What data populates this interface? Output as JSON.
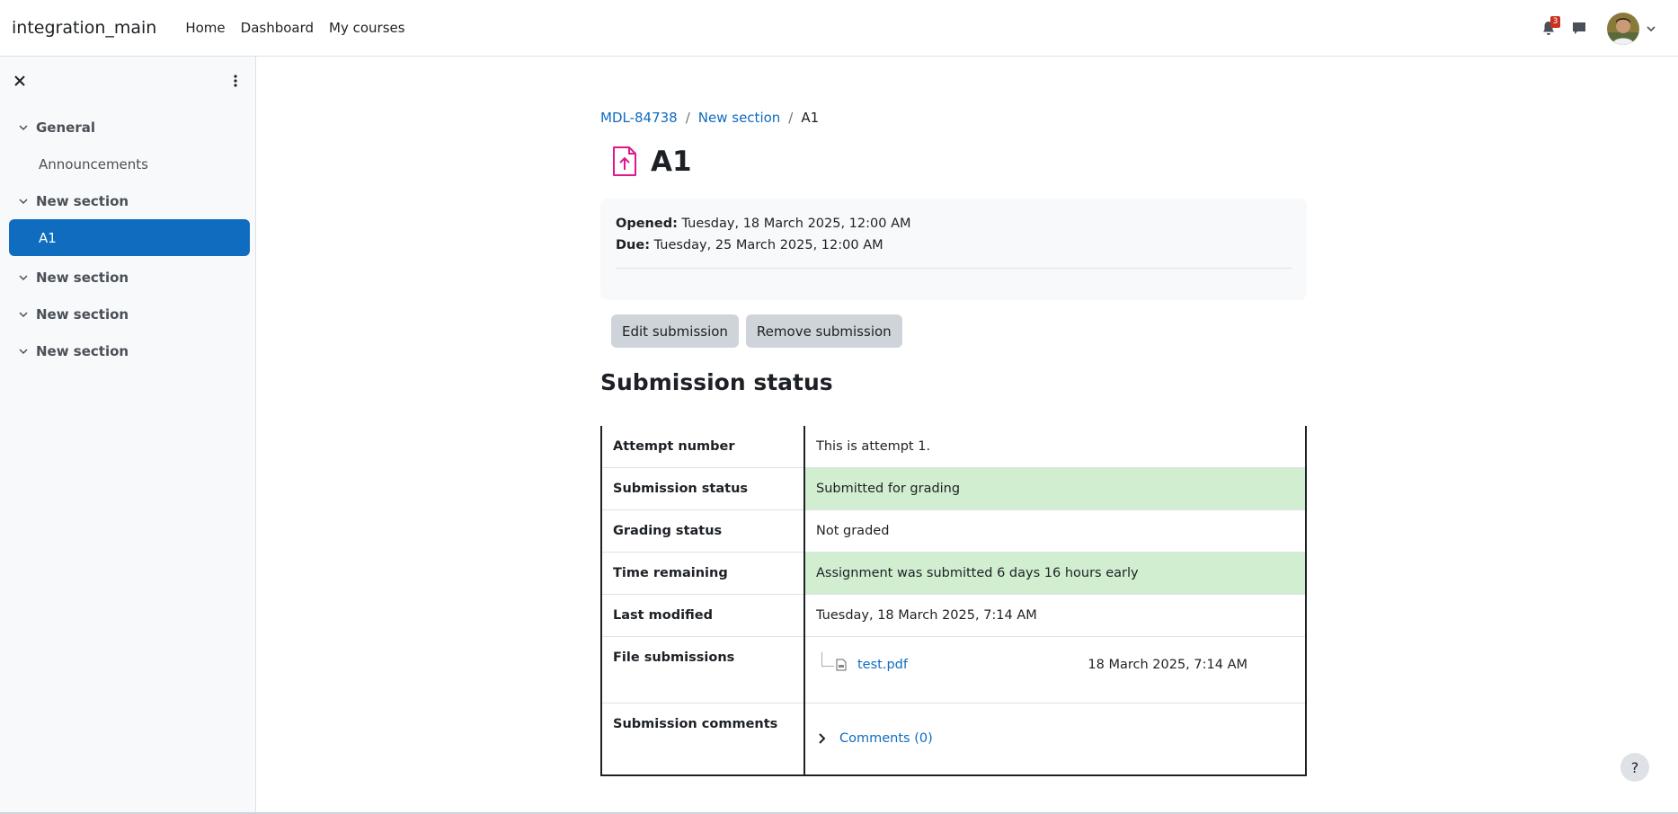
{
  "navbar": {
    "brand": "integration_main",
    "links": [
      "Home",
      "Dashboard",
      "My courses"
    ],
    "notification_count": "3"
  },
  "drawer": {
    "sections": [
      {
        "title": "General",
        "items": [
          "Announcements"
        ]
      },
      {
        "title": "New section",
        "items": [
          "A1"
        ]
      },
      {
        "title": "New section",
        "items": []
      },
      {
        "title": "New section",
        "items": []
      },
      {
        "title": "New section",
        "items": []
      }
    ],
    "active_item": "A1"
  },
  "breadcrumb": [
    "MDL-84738",
    "New section",
    "A1"
  ],
  "page_title": "A1",
  "dates": {
    "opened_label": "Opened:",
    "opened_value": "Tuesday, 18 March 2025, 12:00 AM",
    "due_label": "Due:",
    "due_value": "Tuesday, 25 March 2025, 12:00 AM"
  },
  "buttons": {
    "edit": "Edit submission",
    "remove": "Remove submission"
  },
  "status_heading": "Submission status",
  "status_table": [
    {
      "label": "Attempt number",
      "value": "This is attempt 1.",
      "highlight": false
    },
    {
      "label": "Submission status",
      "value": "Submitted for grading",
      "highlight": true
    },
    {
      "label": "Grading status",
      "value": "Not graded",
      "highlight": false
    },
    {
      "label": "Time remaining",
      "value": "Assignment was submitted 6 days 16 hours early",
      "highlight": true
    },
    {
      "label": "Last modified",
      "value": "Tuesday, 18 March 2025, 7:14 AM",
      "highlight": false
    }
  ],
  "file_submissions": {
    "label": "File submissions",
    "file_name": "test.pdf",
    "file_date": "18 March 2025, 7:14 AM"
  },
  "submission_comments": {
    "label": "Submission comments",
    "link": "Comments (0)"
  },
  "help_label": "?",
  "colors": {
    "primary": "#0f6cbf",
    "highlight_row": "#d2eed0",
    "activity_icon": "#e0188e"
  }
}
